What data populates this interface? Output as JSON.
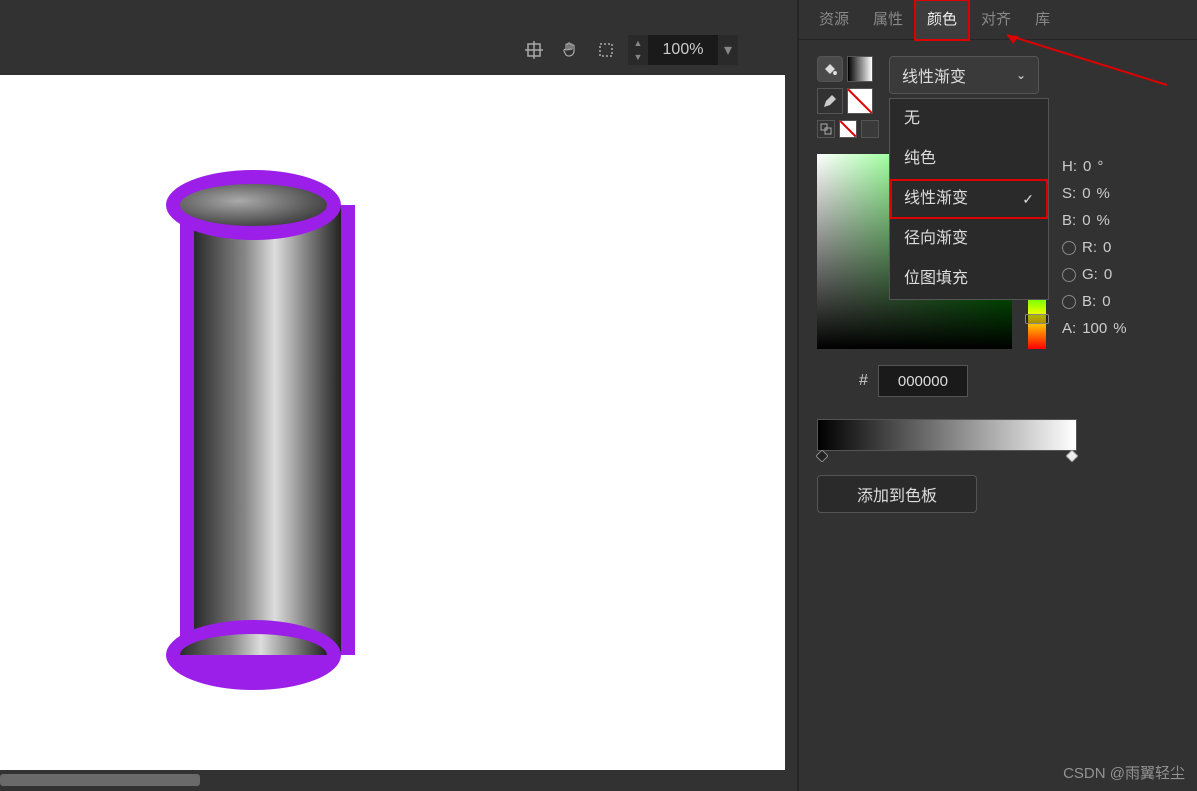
{
  "toolbar": {
    "zoom": "100%"
  },
  "panel": {
    "tabs": [
      "资源",
      "属性",
      "颜色",
      "对齐",
      "库"
    ],
    "activeTabIndex": 2
  },
  "gradientDropdown": {
    "label": "线性渐变",
    "options": [
      "无",
      "纯色",
      "线性渐变",
      "径向渐变",
      "位图填充"
    ],
    "selectedIndex": 2
  },
  "colorValues": {
    "H": {
      "label": "H:",
      "val": "0",
      "unit": "°"
    },
    "S": {
      "label": "S:",
      "val": "0",
      "unit": "%"
    },
    "B": {
      "label": "B:",
      "val": "0",
      "unit": "%"
    },
    "R": {
      "label": "R:",
      "val": "0"
    },
    "G": {
      "label": "G:",
      "val": "0"
    },
    "Bc": {
      "label": "B:",
      "val": "0"
    },
    "A": {
      "label": "A:",
      "val": "100",
      "unit": "%"
    }
  },
  "hex": {
    "label": "#",
    "value": "000000"
  },
  "addSwatch": "添加到色板",
  "watermark": "CSDN @雨翼轻尘"
}
